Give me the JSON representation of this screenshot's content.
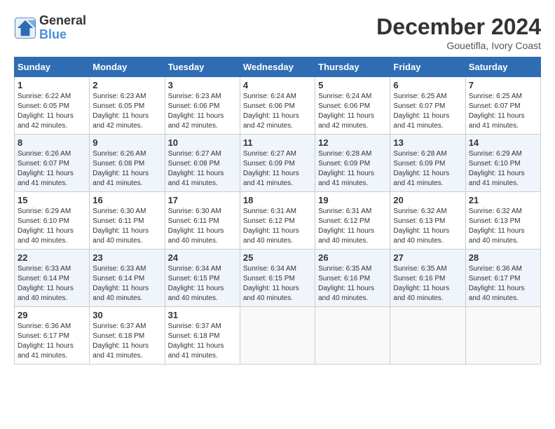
{
  "header": {
    "logo_line1": "General",
    "logo_line2": "Blue",
    "title": "December 2024",
    "subtitle": "Gouetifla, Ivory Coast"
  },
  "calendar": {
    "days_of_week": [
      "Sunday",
      "Monday",
      "Tuesday",
      "Wednesday",
      "Thursday",
      "Friday",
      "Saturday"
    ],
    "weeks": [
      [
        null,
        null,
        null,
        null,
        null,
        null,
        null
      ],
      null,
      null,
      null,
      null,
      null
    ],
    "cells": [
      [
        null,
        {
          "day": 2,
          "sunrise": "6:23 AM",
          "sunset": "6:05 PM",
          "daylight": "11 hours and 42 minutes."
        },
        {
          "day": 3,
          "sunrise": "6:23 AM",
          "sunset": "6:06 PM",
          "daylight": "11 hours and 42 minutes."
        },
        {
          "day": 4,
          "sunrise": "6:24 AM",
          "sunset": "6:06 PM",
          "daylight": "11 hours and 42 minutes."
        },
        {
          "day": 5,
          "sunrise": "6:24 AM",
          "sunset": "6:06 PM",
          "daylight": "11 hours and 42 minutes."
        },
        {
          "day": 6,
          "sunrise": "6:25 AM",
          "sunset": "6:07 PM",
          "daylight": "11 hours and 41 minutes."
        },
        {
          "day": 7,
          "sunrise": "6:25 AM",
          "sunset": "6:07 PM",
          "daylight": "11 hours and 41 minutes."
        }
      ],
      [
        {
          "day": 8,
          "sunrise": "6:26 AM",
          "sunset": "6:07 PM",
          "daylight": "11 hours and 41 minutes."
        },
        {
          "day": 9,
          "sunrise": "6:26 AM",
          "sunset": "6:08 PM",
          "daylight": "11 hours and 41 minutes."
        },
        {
          "day": 10,
          "sunrise": "6:27 AM",
          "sunset": "6:08 PM",
          "daylight": "11 hours and 41 minutes."
        },
        {
          "day": 11,
          "sunrise": "6:27 AM",
          "sunset": "6:09 PM",
          "daylight": "11 hours and 41 minutes."
        },
        {
          "day": 12,
          "sunrise": "6:28 AM",
          "sunset": "6:09 PM",
          "daylight": "11 hours and 41 minutes."
        },
        {
          "day": 13,
          "sunrise": "6:28 AM",
          "sunset": "6:09 PM",
          "daylight": "11 hours and 41 minutes."
        },
        {
          "day": 14,
          "sunrise": "6:29 AM",
          "sunset": "6:10 PM",
          "daylight": "11 hours and 41 minutes."
        }
      ],
      [
        {
          "day": 15,
          "sunrise": "6:29 AM",
          "sunset": "6:10 PM",
          "daylight": "11 hours and 40 minutes."
        },
        {
          "day": 16,
          "sunrise": "6:30 AM",
          "sunset": "6:11 PM",
          "daylight": "11 hours and 40 minutes."
        },
        {
          "day": 17,
          "sunrise": "6:30 AM",
          "sunset": "6:11 PM",
          "daylight": "11 hours and 40 minutes."
        },
        {
          "day": 18,
          "sunrise": "6:31 AM",
          "sunset": "6:12 PM",
          "daylight": "11 hours and 40 minutes."
        },
        {
          "day": 19,
          "sunrise": "6:31 AM",
          "sunset": "6:12 PM",
          "daylight": "11 hours and 40 minutes."
        },
        {
          "day": 20,
          "sunrise": "6:32 AM",
          "sunset": "6:13 PM",
          "daylight": "11 hours and 40 minutes."
        },
        {
          "day": 21,
          "sunrise": "6:32 AM",
          "sunset": "6:13 PM",
          "daylight": "11 hours and 40 minutes."
        }
      ],
      [
        {
          "day": 22,
          "sunrise": "6:33 AM",
          "sunset": "6:14 PM",
          "daylight": "11 hours and 40 minutes."
        },
        {
          "day": 23,
          "sunrise": "6:33 AM",
          "sunset": "6:14 PM",
          "daylight": "11 hours and 40 minutes."
        },
        {
          "day": 24,
          "sunrise": "6:34 AM",
          "sunset": "6:15 PM",
          "daylight": "11 hours and 40 minutes."
        },
        {
          "day": 25,
          "sunrise": "6:34 AM",
          "sunset": "6:15 PM",
          "daylight": "11 hours and 40 minutes."
        },
        {
          "day": 26,
          "sunrise": "6:35 AM",
          "sunset": "6:16 PM",
          "daylight": "11 hours and 40 minutes."
        },
        {
          "day": 27,
          "sunrise": "6:35 AM",
          "sunset": "6:16 PM",
          "daylight": "11 hours and 40 minutes."
        },
        {
          "day": 28,
          "sunrise": "6:36 AM",
          "sunset": "6:17 PM",
          "daylight": "11 hours and 40 minutes."
        }
      ],
      [
        {
          "day": 29,
          "sunrise": "6:36 AM",
          "sunset": "6:17 PM",
          "daylight": "11 hours and 41 minutes."
        },
        {
          "day": 30,
          "sunrise": "6:37 AM",
          "sunset": "6:18 PM",
          "daylight": "11 hours and 41 minutes."
        },
        {
          "day": 31,
          "sunrise": "6:37 AM",
          "sunset": "6:18 PM",
          "daylight": "11 hours and 41 minutes."
        },
        null,
        null,
        null,
        null
      ]
    ]
  }
}
